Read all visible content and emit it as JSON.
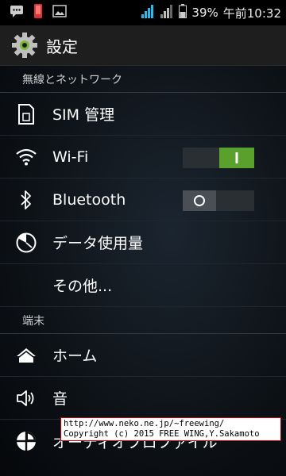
{
  "status_bar": {
    "battery_percent": "39%",
    "time": "午前10:32"
  },
  "action_bar": {
    "title": "設定"
  },
  "sections": {
    "wireless_header": "無線とネットワーク",
    "device_header": "端末"
  },
  "items": {
    "sim": "SIM 管理",
    "wifi": "Wi-Fi",
    "bluetooth": "Bluetooth",
    "data_usage": "データ使用量",
    "more": "その他...",
    "home": "ホーム",
    "sound": "音",
    "audio_profile": "オーディオプロファイル"
  },
  "toggles": {
    "wifi_state": "on",
    "bluetooth_state": "off"
  },
  "watermark": {
    "url": "http://www.neko.ne.jp/~freewing/",
    "copyright": "Copyright (c) 2015 FREE WING,Y.Sakamoto"
  },
  "colors": {
    "toggle_on": "#5aa02c",
    "accent_wifi": "#33b5e5"
  }
}
